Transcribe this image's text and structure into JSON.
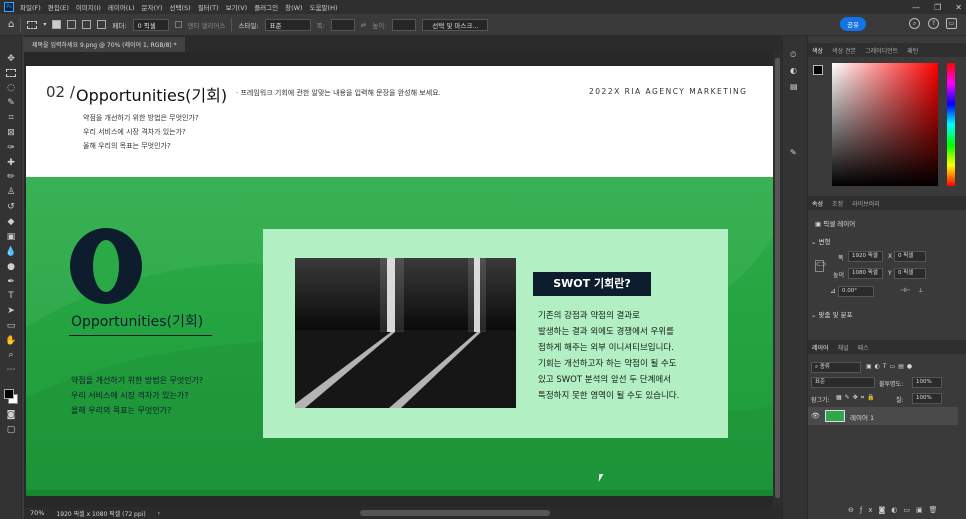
{
  "app": {
    "logo": "Ps",
    "menu": [
      "파일(F)",
      "편집(E)",
      "이미지(I)",
      "레이어(L)",
      "문자(Y)",
      "선택(S)",
      "필터(T)",
      "보기(V)",
      "플러그인",
      "창(W)",
      "도움말(H)"
    ],
    "window_controls": [
      "—",
      "❐",
      "✕"
    ]
  },
  "options": {
    "feather_label": "페더:",
    "feather_value": "0 픽셀",
    "antialias_label": "앤티 앨리어스",
    "style_label": "스타일:",
    "style_value": "표준",
    "width_label": "폭:",
    "height_label": "높이:",
    "select_mask_button": "선택 및 마스크...",
    "share_button": "공유"
  },
  "document": {
    "tab_title": "제목을 입력하세요 9.png @ 70% (레이어 1, RGB/8) *",
    "zoom": "70%",
    "dimensions": "1920 픽셀 x 1080 픽셀 (72 ppi)"
  },
  "slide": {
    "number": "02 /",
    "title": "Opportunities(기회)",
    "description": "· 프레임워크 기회에 관한 알맞는 내용을 입력해 문장을 완성해 보세요.",
    "agency": "2022X RIA AGENCY MARKETING",
    "questions": [
      "약점을 개선하기 위한 방법은 무엇인가?",
      "우리 서비스에 시장 격차가 있는가?",
      "올해 우리의 목표는 무엇인가?"
    ],
    "big_letter_label": "Opportunities(기회)",
    "green_questions": [
      "약점을 개선하기 위한 방법은 무엇인가?",
      "우리 서비스에 시장 격차가 있는가?",
      "올해 우리의 목표는 무엇인가?"
    ],
    "swot_heading": "SWOT 기회란?",
    "swot_lines": [
      "기존의 강점과 약점의 결과로",
      "발생하는 결과 외에도 경쟁에서 우위를",
      "점하게 해주는 외부 이니셔티브입니다.",
      "기회는 개선하고자 하는 약점이 될 수도",
      "있고 SWOT 분석의 앞선 두 단계에서",
      "특정하지 못한 영역이 될 수도 있습니다."
    ]
  },
  "panels": {
    "color_tabs": [
      "색상",
      "색상 견본",
      "그레이디언트",
      "패턴"
    ],
    "prop_tabs": [
      "속성",
      "조정",
      "라이브러리"
    ],
    "pixel_layer": "픽셀 레이어",
    "transform_heading": "변형",
    "w_label": "폭",
    "w_value": "1920 픽셀",
    "x_label": "X",
    "x_value": "0 픽셀",
    "h_label": "높이",
    "h_value": "1080 픽셀",
    "y_label": "Y",
    "y_value": "0 픽셀",
    "angle_value": "0.00°",
    "align_heading": "맞춤 및 분포",
    "layer_tabs": [
      "레이어",
      "채널",
      "패스"
    ],
    "kind_label": "종류",
    "blend_value": "표준",
    "opacity_label": "불투명도:",
    "opacity_value": "100%",
    "lock_label": "잠그기:",
    "fill_label": "칠:",
    "fill_value": "100%",
    "layer_name": "레이어 1"
  }
}
